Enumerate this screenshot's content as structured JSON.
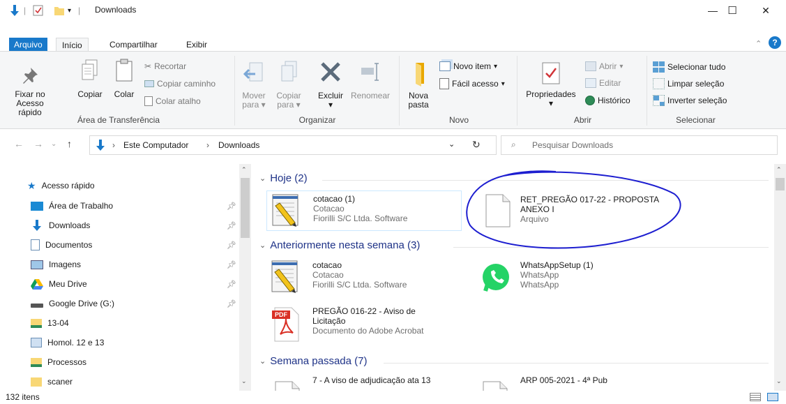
{
  "window": {
    "title": "Downloads",
    "controls": {
      "minimize": "—",
      "maximize": "☐",
      "close": "✕"
    }
  },
  "ribbon_tabs": {
    "file": "Arquivo",
    "home": "Início",
    "share": "Compartilhar",
    "view": "Exibir"
  },
  "ribbon": {
    "clipboard": {
      "label": "Área de Transferência",
      "pin_l1": "Fixar no",
      "pin_l2": "Acesso rápido",
      "copy": "Copiar",
      "paste": "Colar",
      "cut": "Recortar",
      "copy_path": "Copiar caminho",
      "paste_shortcut": "Colar atalho"
    },
    "organize": {
      "label": "Organizar",
      "move_l1": "Mover",
      "move_l2": "para",
      "copy_l1": "Copiar",
      "copy_l2": "para",
      "delete": "Excluir",
      "rename": "Renomear"
    },
    "new": {
      "label": "Novo",
      "new_folder_l1": "Nova",
      "new_folder_l2": "pasta",
      "new_item": "Novo item",
      "easy_access": "Fácil acesso"
    },
    "open": {
      "label": "Abrir",
      "properties": "Propriedades",
      "open": "Abrir",
      "edit": "Editar",
      "history": "Histórico"
    },
    "select": {
      "label": "Selecionar",
      "select_all": "Selecionar tudo",
      "select_none": "Limpar seleção",
      "invert": "Inverter seleção"
    }
  },
  "address": {
    "crumb1": "Este Computador",
    "crumb2": "Downloads",
    "search_placeholder": "Pesquisar Downloads"
  },
  "nav": {
    "items": [
      {
        "label": "Acesso rápido"
      },
      {
        "label": "Área de Trabalho"
      },
      {
        "label": "Downloads"
      },
      {
        "label": "Documentos"
      },
      {
        "label": "Imagens"
      },
      {
        "label": "Meu Drive"
      },
      {
        "label": "Google Drive (G:)"
      },
      {
        "label": "13-04"
      },
      {
        "label": "Homol. 12 e 13"
      },
      {
        "label": "Processos"
      },
      {
        "label": "scaner"
      }
    ]
  },
  "groups": {
    "today": "Hoje (2)",
    "this_week": "Anteriormente nesta semana (3)",
    "last_week": "Semana passada (7)"
  },
  "files": {
    "f1": {
      "name": "cotacao (1)",
      "type": "Cotacao",
      "company": "Fiorilli S/C Ltda. Software"
    },
    "f2": {
      "name_l1": "RET_PREGÃO 017-22 - PROPOSTA",
      "name_l2": "ANEXO I",
      "type": "Arquivo"
    },
    "f3": {
      "name": "cotacao",
      "type": "Cotacao",
      "company": "Fiorilli S/C Ltda. Software"
    },
    "f4": {
      "name": "WhatsAppSetup (1)",
      "type": "WhatsApp",
      "company": "WhatsApp"
    },
    "f5": {
      "name_l1": "PREGÃO 016-22 - Aviso de",
      "name_l2": "Licitação",
      "type": "Documento do Adobe Acrobat",
      "badge": "PDF"
    },
    "f6": {
      "name": "7 - A viso de adjudicação ata 13"
    },
    "f7": {
      "name": "ARP 005-2021 - 4ª Pub"
    }
  },
  "status": {
    "count": "132 itens"
  },
  "colors": {
    "accent": "#1979ca",
    "group_header": "#1e3287",
    "annotation": "#1d1ed0"
  }
}
